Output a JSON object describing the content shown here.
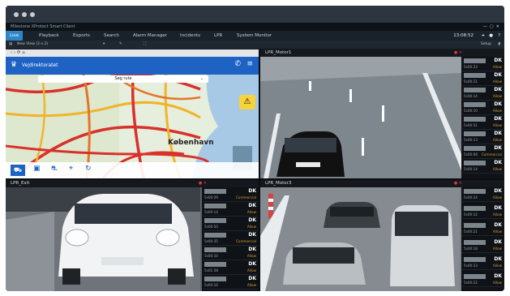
{
  "app": {
    "title": "Milestone XProtect Smart Client"
  },
  "menu": {
    "tabs": [
      "Live",
      "Playback",
      "Exports",
      "Search",
      "Alarm Manager",
      "Incidents",
      "LPR",
      "System Monitor"
    ],
    "active": "Live",
    "clock": "13:08:52"
  },
  "viewbar": {
    "view_name": "New View (2 x 2)",
    "setup_label": "Setup"
  },
  "cells": {
    "map": {
      "app_title": "Vejdirektoratet",
      "search_text": "Søg rute",
      "city_label": "København"
    },
    "motor1": {
      "title": "LPR_Motor1"
    },
    "exit": {
      "title": "LPR_Exit"
    },
    "motor3": {
      "title": "LPR_Motor3"
    }
  },
  "list_exit": [
    {
      "plate": "DK",
      "time": "5s00:29",
      "status": "Commercial"
    },
    {
      "plate": "DK",
      "time": "5s00:14",
      "status": "Allow"
    },
    {
      "plate": "DK",
      "time": "5s00:50",
      "status": "Allow"
    },
    {
      "plate": "DK",
      "time": "5s00:35",
      "status": "Commercial"
    },
    {
      "plate": "DK",
      "time": "5s00:10",
      "status": "Allow"
    },
    {
      "plate": "DK",
      "time": "5s01:58",
      "status": "Allow"
    },
    {
      "plate": "DK",
      "time": "5s00:16",
      "status": "Allow"
    }
  ],
  "list_motor1": [
    {
      "plate": "DK",
      "time": "5s00:23",
      "status": "Allow"
    },
    {
      "plate": "DK",
      "time": "5s00:21",
      "status": "Allow"
    },
    {
      "plate": "DK",
      "time": "5s00:14",
      "status": "Allow"
    },
    {
      "plate": "DK",
      "time": "5s00:10",
      "status": "Allow"
    },
    {
      "plate": "DK",
      "time": "5s00:51",
      "status": "Allow"
    },
    {
      "plate": "DK",
      "time": "5s00:13",
      "status": "Allow"
    },
    {
      "plate": "DK",
      "time": "5s00:08",
      "status": "Commercial"
    },
    {
      "plate": "DK",
      "time": "5s00:14",
      "status": "Allow"
    }
  ],
  "list_motor3": [
    {
      "plate": "DK",
      "time": "5s00:24",
      "status": "Allow"
    },
    {
      "plate": "DK",
      "time": "5s00:12",
      "status": "Allow"
    },
    {
      "plate": "DK",
      "time": "5s00:21",
      "status": "Allow"
    },
    {
      "plate": "DK",
      "time": "5s00:18",
      "status": "Allow"
    },
    {
      "plate": "DK",
      "time": "5s00:23",
      "status": "Allow"
    },
    {
      "plate": "DK",
      "time": "5s00:22",
      "status": "Allow"
    }
  ],
  "colors": {
    "accent": "#2e86c9",
    "alert": "#d93b3b",
    "status_text": "#d99a2b"
  }
}
